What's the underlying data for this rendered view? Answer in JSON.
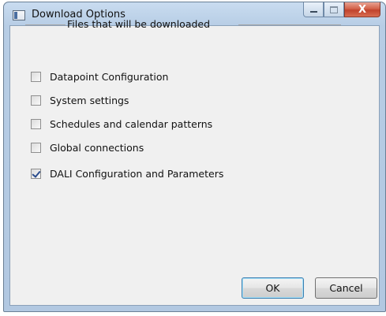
{
  "window": {
    "title": "Download Options",
    "close_glyph": "X"
  },
  "group": {
    "label": "Files that will be downloaded"
  },
  "options": [
    {
      "label": "Datapoint Configuration",
      "checked": false
    },
    {
      "label": "System settings",
      "checked": false
    },
    {
      "label": "Schedules and calendar patterns",
      "checked": false
    },
    {
      "label": "Global connections",
      "checked": false
    },
    {
      "label": "DALI Configuration and Parameters",
      "checked": true
    }
  ],
  "buttons": {
    "ok_label": "OK",
    "cancel_label": "Cancel"
  },
  "colors": {
    "frame": "#b7cde5",
    "client": "#f0f0f0",
    "close": "#c0432c"
  }
}
